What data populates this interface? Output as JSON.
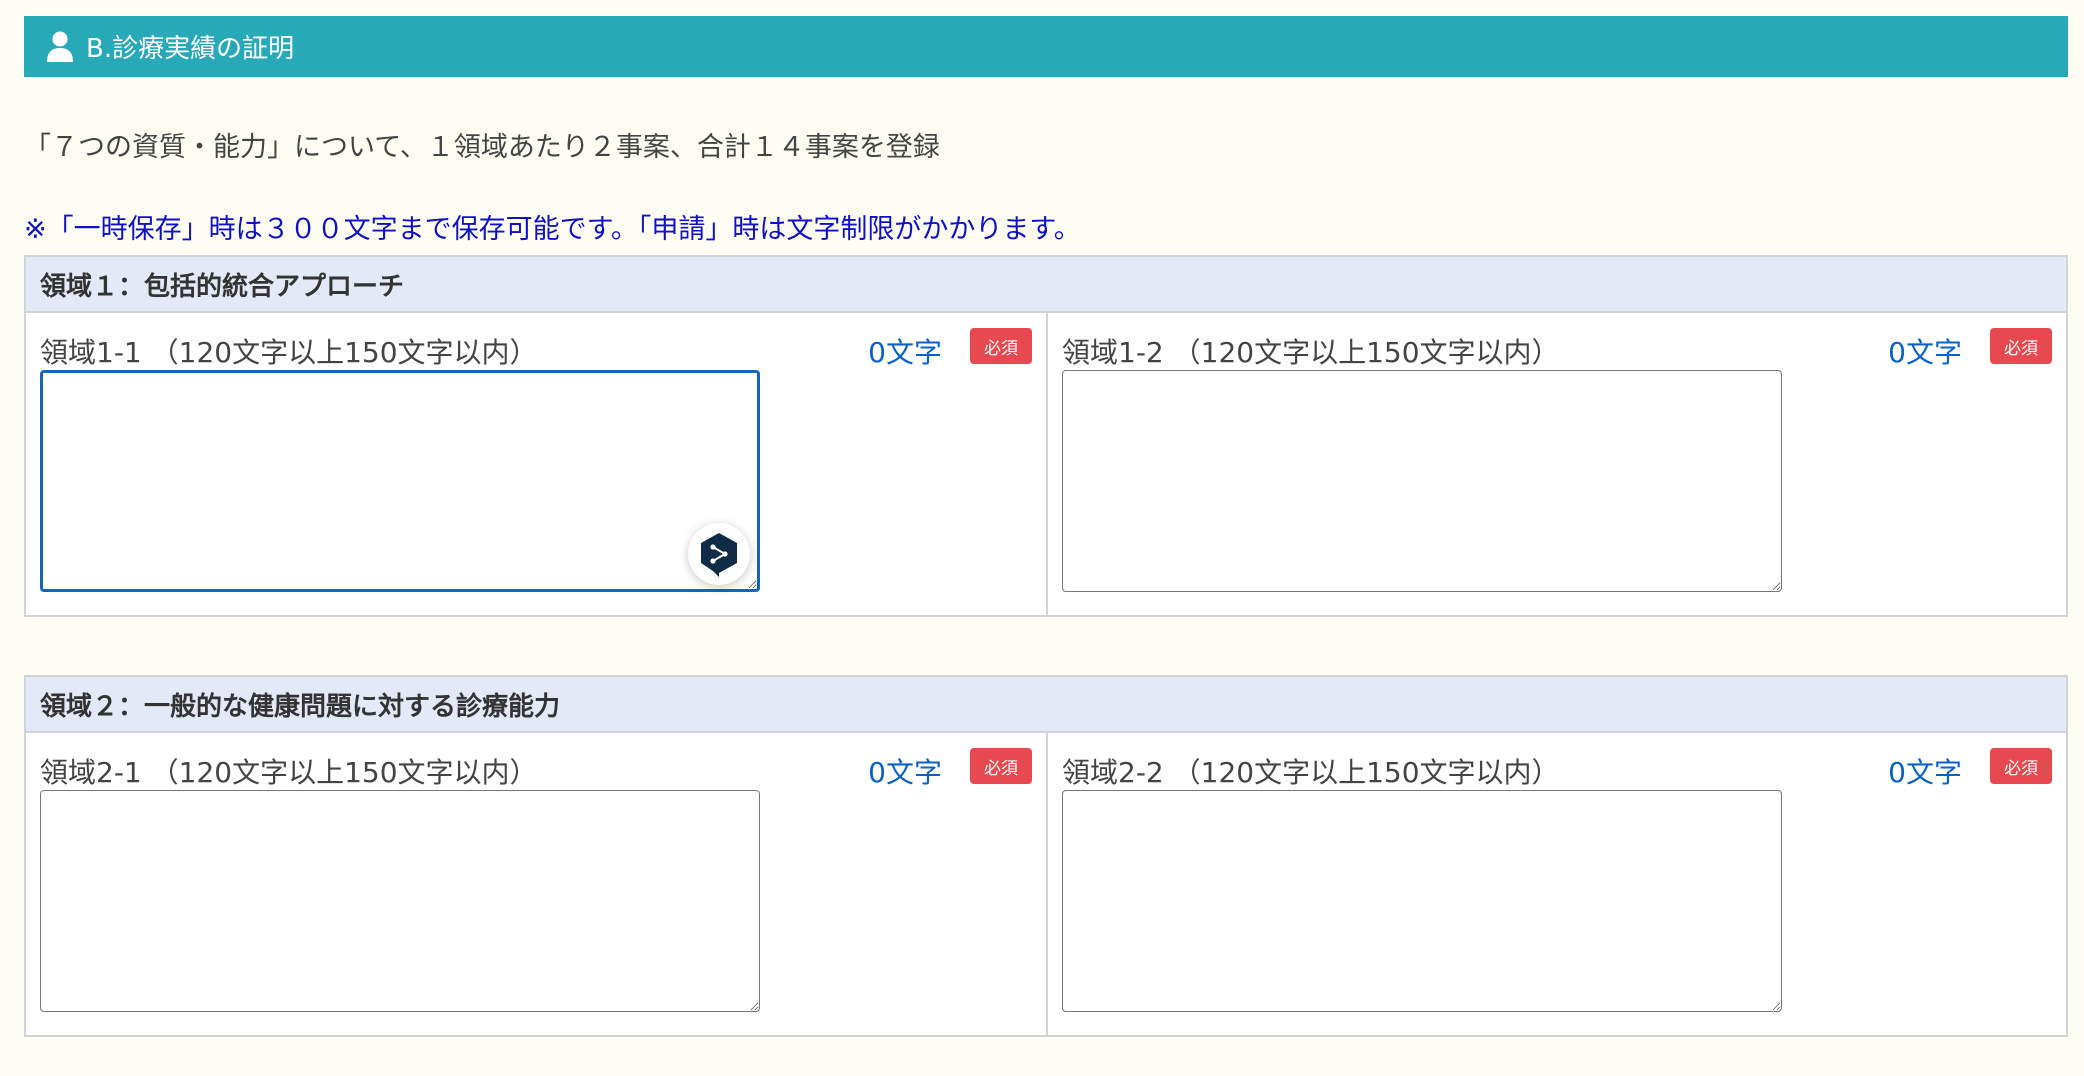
{
  "header": {
    "title": "B.診療実績の証明"
  },
  "intro": "「７つの資質・能力」について、１領域あたり２事案、合計１４事案を登録",
  "note": "※「一時保存」時は３００文字まで保存可能です。「申請」時は文字制限がかかります。",
  "domains": [
    {
      "title": "領域１：包括的統合アプローチ",
      "items": [
        {
          "label": "領域1-1 （120文字以上150文字以内）",
          "count": "0文字",
          "required": "必須",
          "value": ""
        },
        {
          "label": "領域1-2 （120文字以上150文字以内）",
          "count": "0文字",
          "required": "必須",
          "value": ""
        }
      ]
    },
    {
      "title": "領域２：一般的な健康問題に対する診療能力",
      "items": [
        {
          "label": "領域2-1 （120文字以上150文字以内）",
          "count": "0文字",
          "required": "必須",
          "value": ""
        },
        {
          "label": "領域2-2 （120文字以上150文字以内）",
          "count": "0文字",
          "required": "必須",
          "value": ""
        }
      ]
    }
  ],
  "colors": {
    "header_bg": "#28a9b8",
    "domain_head_bg": "#e3e9f6",
    "required_bg": "#e8484f",
    "count_text": "#0a62c9",
    "note_text": "#1010cc",
    "focus_border": "#1565c0"
  },
  "icons": {
    "header": "person-icon",
    "floating": "translate-assistant-icon"
  }
}
